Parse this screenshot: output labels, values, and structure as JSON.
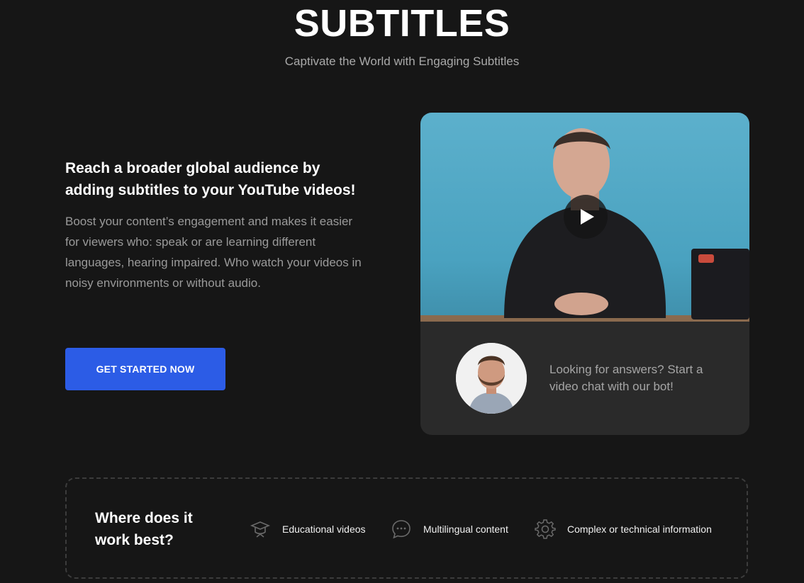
{
  "hero": {
    "title": "SUBTITLES",
    "subtitle": "Captivate the World with Engaging Subtitles"
  },
  "intro": {
    "headline": "Reach a broader global audience by adding subtitles to your YouTube videos!",
    "body": "Boost your content’s engagement and makes it easier for viewers who: speak or are learning different languages, hearing impaired. Who watch your videos in noisy environments or without audio.",
    "cta_label": "GET STARTED NOW"
  },
  "video_card": {
    "play_icon": "play-icon",
    "bot_text": "Looking for answers? Start a video chat with our bot!"
  },
  "best": {
    "title": "Where does it work best?",
    "features": [
      {
        "icon": "graduation-cap-icon",
        "label": "Educational videos"
      },
      {
        "icon": "chat-bubble-icon",
        "label": "Multilingual content"
      },
      {
        "icon": "gear-icon",
        "label": "Complex or technical information"
      }
    ]
  },
  "colors": {
    "background": "#161616",
    "accent": "#2c5ce6",
    "card": "#2a2a2a"
  }
}
